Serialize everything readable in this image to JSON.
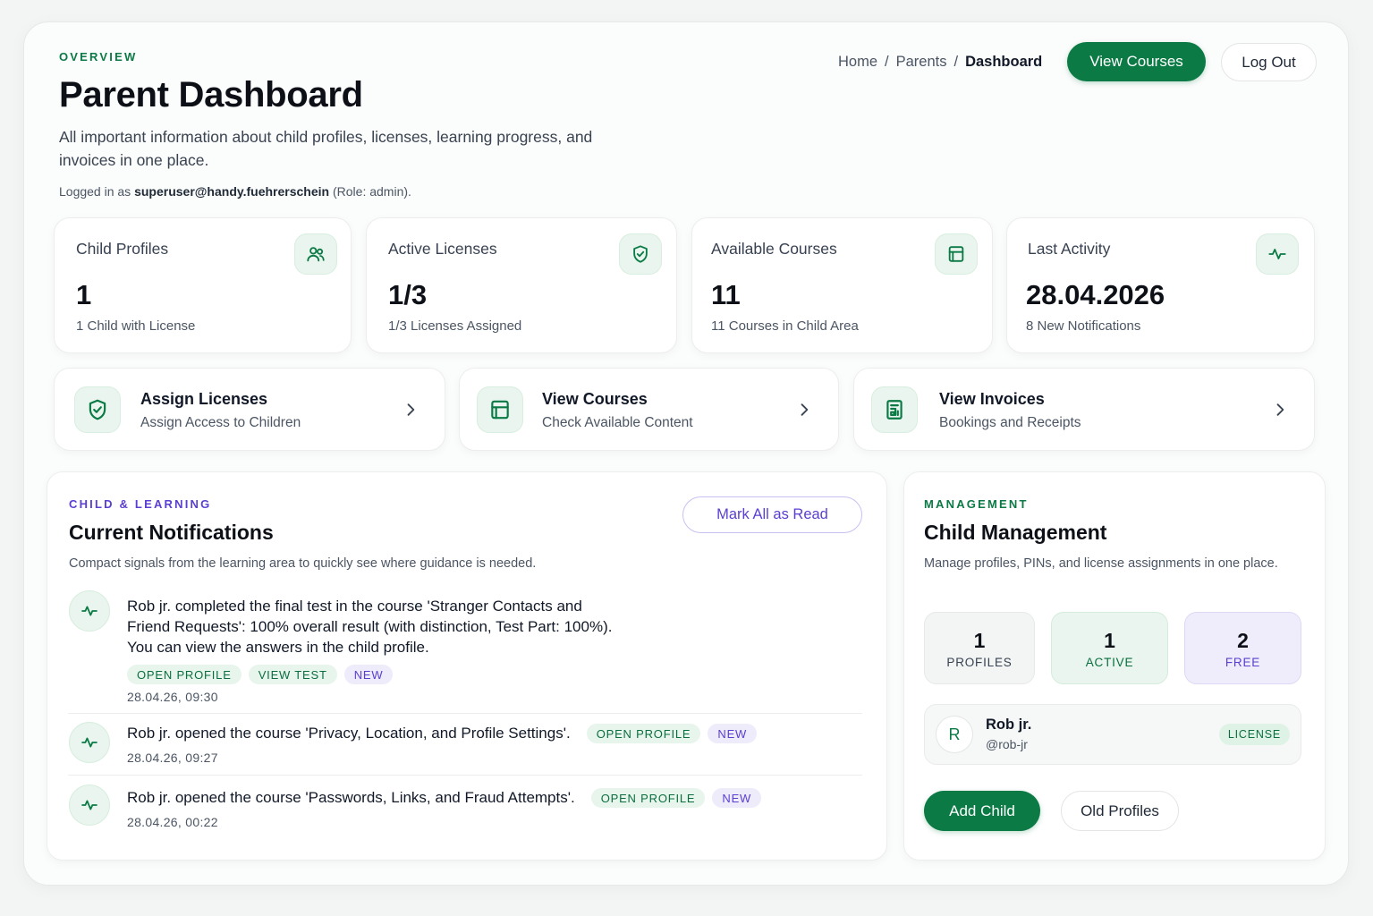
{
  "header": {
    "eyebrow": "OVERVIEW",
    "title": "Parent Dashboard",
    "description": "All important information about child profiles, licenses, learning progress, and invoices in one place.",
    "login_prefix": "Logged in as ",
    "login_user": "superuser@handy.fuehrerschein",
    "login_suffix": " (Role: admin)."
  },
  "breadcrumb": {
    "items": [
      "Home",
      "Parents",
      "Dashboard"
    ],
    "separator": "/"
  },
  "top_buttons": {
    "view_courses": "View Courses",
    "log_out": "Log Out"
  },
  "stats": [
    {
      "label": "Child Profiles",
      "value": "1",
      "sub": "1 Child with License",
      "icon": "users-icon"
    },
    {
      "label": "Active Licenses",
      "value": "1/3",
      "sub": "1/3 Licenses Assigned",
      "icon": "shield-check-icon"
    },
    {
      "label": "Available Courses",
      "value": "11",
      "sub": "11 Courses in Child Area",
      "icon": "book-icon"
    },
    {
      "label": "Last Activity",
      "value": "28.04.2026",
      "sub": "8 New Notifications",
      "icon": "activity-icon"
    }
  ],
  "actions": [
    {
      "title": "Assign Licenses",
      "sub": "Assign Access to Children",
      "icon": "shield-check-icon"
    },
    {
      "title": "View Courses",
      "sub": "Check Available Content",
      "icon": "book-icon"
    },
    {
      "title": "View Invoices",
      "sub": "Bookings and Receipts",
      "icon": "receipt-icon"
    }
  ],
  "notifications_panel": {
    "eyebrow": "CHILD & LEARNING",
    "title": "Current Notifications",
    "description": "Compact signals from the learning area to quickly see where guidance is needed.",
    "mark_all_read": "Mark All as Read",
    "items": [
      {
        "text": "Rob jr. completed the final test in the course 'Stranger Contacts and Friend Requests': 100% overall result (with distinction, Test Part: 100%). You can view the answers in the child profile.",
        "tags": [
          "OPEN PROFILE",
          "VIEW TEST",
          "NEW"
        ],
        "time": "28.04.26, 09:30"
      },
      {
        "text": "Rob jr. opened the course 'Privacy, Location, and Profile Settings'.",
        "tags": [
          "OPEN PROFILE",
          "NEW"
        ],
        "time": "28.04.26, 09:27"
      },
      {
        "text": "Rob jr. opened the course 'Passwords, Links, and Fraud Attempts'.",
        "tags": [
          "OPEN PROFILE",
          "NEW"
        ],
        "time": "28.04.26, 00:22"
      }
    ]
  },
  "management": {
    "eyebrow": "MANAGEMENT",
    "title": "Child Management",
    "description": "Manage profiles, PINs, and license assignments in one place.",
    "counters": [
      {
        "value": "1",
        "label": "PROFILES"
      },
      {
        "value": "1",
        "label": "ACTIVE"
      },
      {
        "value": "2",
        "label": "FREE"
      }
    ],
    "child": {
      "initial": "R",
      "name": "Rob jr.",
      "handle": "@rob-jr",
      "badge": "LICENSE"
    },
    "add_child": "Add Child",
    "old_profiles": "Old Profiles"
  },
  "colors": {
    "accent_green": "#0b7a45",
    "accent_purple": "#5b3fd1",
    "icon_bg": "#e9f5ee"
  }
}
